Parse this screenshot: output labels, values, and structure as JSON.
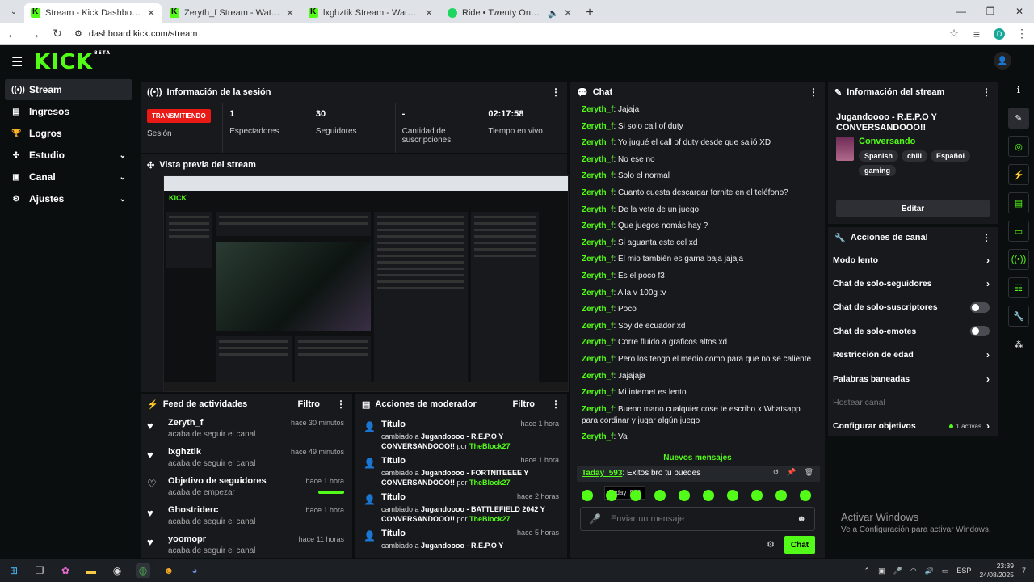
{
  "browser": {
    "tabs": [
      {
        "title": "Stream - Kick Dashboard",
        "fav": "kick"
      },
      {
        "title": "Zeryth_f Stream - Watch Live on Kick",
        "fav": "kick"
      },
      {
        "title": "lxghztik Stream - Watch Live on Kick",
        "fav": "kick"
      },
      {
        "title": "Ride • Twenty One Pilots",
        "fav": "spotify"
      }
    ],
    "url": "dashboard.kick.com/stream",
    "profile_initial": "D"
  },
  "header": {
    "logo": "KICK",
    "beta": "BETA"
  },
  "sidebar": {
    "items": [
      {
        "label": "Stream",
        "icon": "stream-icon"
      },
      {
        "label": "Ingresos",
        "icon": "wallet-icon"
      },
      {
        "label": "Logros",
        "icon": "trophy-icon"
      },
      {
        "label": "Estudio",
        "icon": "studio-icon"
      },
      {
        "label": "Canal",
        "icon": "channel-icon"
      },
      {
        "label": "Ajustes",
        "icon": "gear-icon"
      }
    ]
  },
  "session": {
    "title": "Información de la sesión",
    "live_badge": "TRANSMITIENDO",
    "session_label": "Sesión",
    "stats": [
      {
        "value": "1",
        "label": "Espectadores"
      },
      {
        "value": "30",
        "label": "Seguidores"
      },
      {
        "value": "-",
        "label": "Cantidad de suscripciones"
      },
      {
        "value": "02:17:58",
        "label": "Tiempo en vivo"
      }
    ]
  },
  "preview": {
    "title": "Vista previa del stream"
  },
  "feed": {
    "title": "Feed de actividades",
    "filter": "Filtro",
    "items": [
      {
        "name": "Zeryth_f",
        "sub": "acaba de seguir el canal",
        "time": "hace 30 minutos",
        "icon": "heart-icon"
      },
      {
        "name": "lxghztik",
        "sub": "acaba de seguir el canal",
        "time": "hace 49 minutos",
        "icon": "heart-icon"
      },
      {
        "name": "Objetivo de seguidores",
        "sub": "acaba de empezar",
        "time": "hace 1 hora",
        "icon": "heart-outline-icon",
        "progress": 1.0
      },
      {
        "name": "Ghostriderc",
        "sub": "acaba de seguir el canal",
        "time": "hace 1 hora",
        "icon": "heart-icon"
      },
      {
        "name": "yoomopr",
        "sub": "acaba de seguir el canal",
        "time": "hace 11 horas",
        "icon": "heart-icon"
      }
    ]
  },
  "mod": {
    "title": "Acciones de moderador",
    "filter": "Filtro",
    "items": [
      {
        "title": "Título",
        "time": "hace 1 hora",
        "pre": "cambiado a ",
        "value": "Jugandoooo - R.E.P.O Y CONVERSANDOOO!!",
        "by_pre": " por ",
        "by": "TheBlock27"
      },
      {
        "title": "Título",
        "time": "hace 1 hora",
        "pre": "cambiado a ",
        "value": "Jugandoooo - FORTNITEEEE Y CONVERSANDOOO!!",
        "by_pre": " por ",
        "by": "TheBlock27"
      },
      {
        "title": "Título",
        "time": "hace 2 horas",
        "pre": "cambiado a ",
        "value": "Jugandoooo - BATTLEFIELD 2042 Y CONVERSANDOOO!!",
        "by_pre": " por ",
        "by": "TheBlock27"
      },
      {
        "title": "Título",
        "time": "hace 5 horas",
        "pre": "cambiado a ",
        "value": "Jugandoooo - R.E.P.O Y",
        "by_pre": "",
        "by": ""
      }
    ]
  },
  "chat": {
    "title": "Chat",
    "messages": [
      {
        "user": "Zeryth_f",
        "text": "Jajaja"
      },
      {
        "user": "Zeryth_f",
        "text": "Si solo call of duty"
      },
      {
        "user": "Zeryth_f",
        "text": "Yo jugué el call of duty desde que salió XD"
      },
      {
        "user": "Zeryth_f",
        "text": "No ese no"
      },
      {
        "user": "Zeryth_f",
        "text": "Solo el normal"
      },
      {
        "user": "Zeryth_f",
        "text": "Cuanto cuesta descargar fornite en el teléfono?"
      },
      {
        "user": "Zeryth_f",
        "text": "De la veta de un juego"
      },
      {
        "user": "Zeryth_f",
        "text": "Que juegos nomás hay ?"
      },
      {
        "user": "Zeryth_f",
        "text": "Si aguanta este cel xd"
      },
      {
        "user": "Zeryth_f",
        "text": "El mio también es gama baja jajaja"
      },
      {
        "user": "Zeryth_f",
        "text": "Es el poco f3"
      },
      {
        "user": "Zeryth_f",
        "text": "A la v 100g :v"
      },
      {
        "user": "Zeryth_f",
        "text": "Poco"
      },
      {
        "user": "Zeryth_f",
        "text": "Soy de ecuador xd"
      },
      {
        "user": "Zeryth_f",
        "text": "Corre fluido a graficos altos xd"
      },
      {
        "user": "Zeryth_f",
        "text": "Pero los tengo el medio como para que no se caliente"
      },
      {
        "user": "Zeryth_f",
        "text": "Jajajaja"
      },
      {
        "user": "Zeryth_f",
        "text": "Mi internet es lento"
      },
      {
        "user": "Zeryth_f",
        "text": "Bueno mano cualquier cose te escribo x Whatsapp para cordinar y jugar algún juego"
      },
      {
        "user": "Zeryth_f",
        "text": "Va"
      }
    ],
    "new_messages": "Nuevos mensajes",
    "highlighted": {
      "user": "Taday_593",
      "text": "Exitos bro tu puedes"
    },
    "tooltip": "Taday_593",
    "input_placeholder": "Enviar un mensaje",
    "send_label": "Chat"
  },
  "stream_info": {
    "title": "Información del stream",
    "stream_title": "Jugandoooo - R.E.P.O Y CONVERSANDOOO!!",
    "category": "Conversando",
    "tags": [
      "Spanish",
      "chill",
      "Español",
      "gaming"
    ],
    "edit_label": "Editar"
  },
  "channel_actions": {
    "title": "Acciones de canal",
    "items": [
      {
        "label": "Modo lento",
        "kind": "arrow"
      },
      {
        "label": "Chat de solo-seguidores",
        "kind": "arrow"
      },
      {
        "label": "Chat de solo-suscriptores",
        "kind": "toggle"
      },
      {
        "label": "Chat de solo-emotes",
        "kind": "toggle"
      },
      {
        "label": "Restricción de edad",
        "kind": "arrow"
      },
      {
        "label": "Palabras baneadas",
        "kind": "arrow"
      },
      {
        "label": "Hostear canal",
        "kind": "disabled"
      },
      {
        "label": "Configurar objetivos",
        "kind": "goal",
        "extra": "1 activas"
      }
    ]
  },
  "watermark": {
    "line1": "Activar Windows",
    "line2": "Ve a Configuración para activar Windows."
  },
  "taskbar": {
    "lang": "ESP",
    "time": "23:39",
    "date": "24/08/2025",
    "notif": "7"
  }
}
